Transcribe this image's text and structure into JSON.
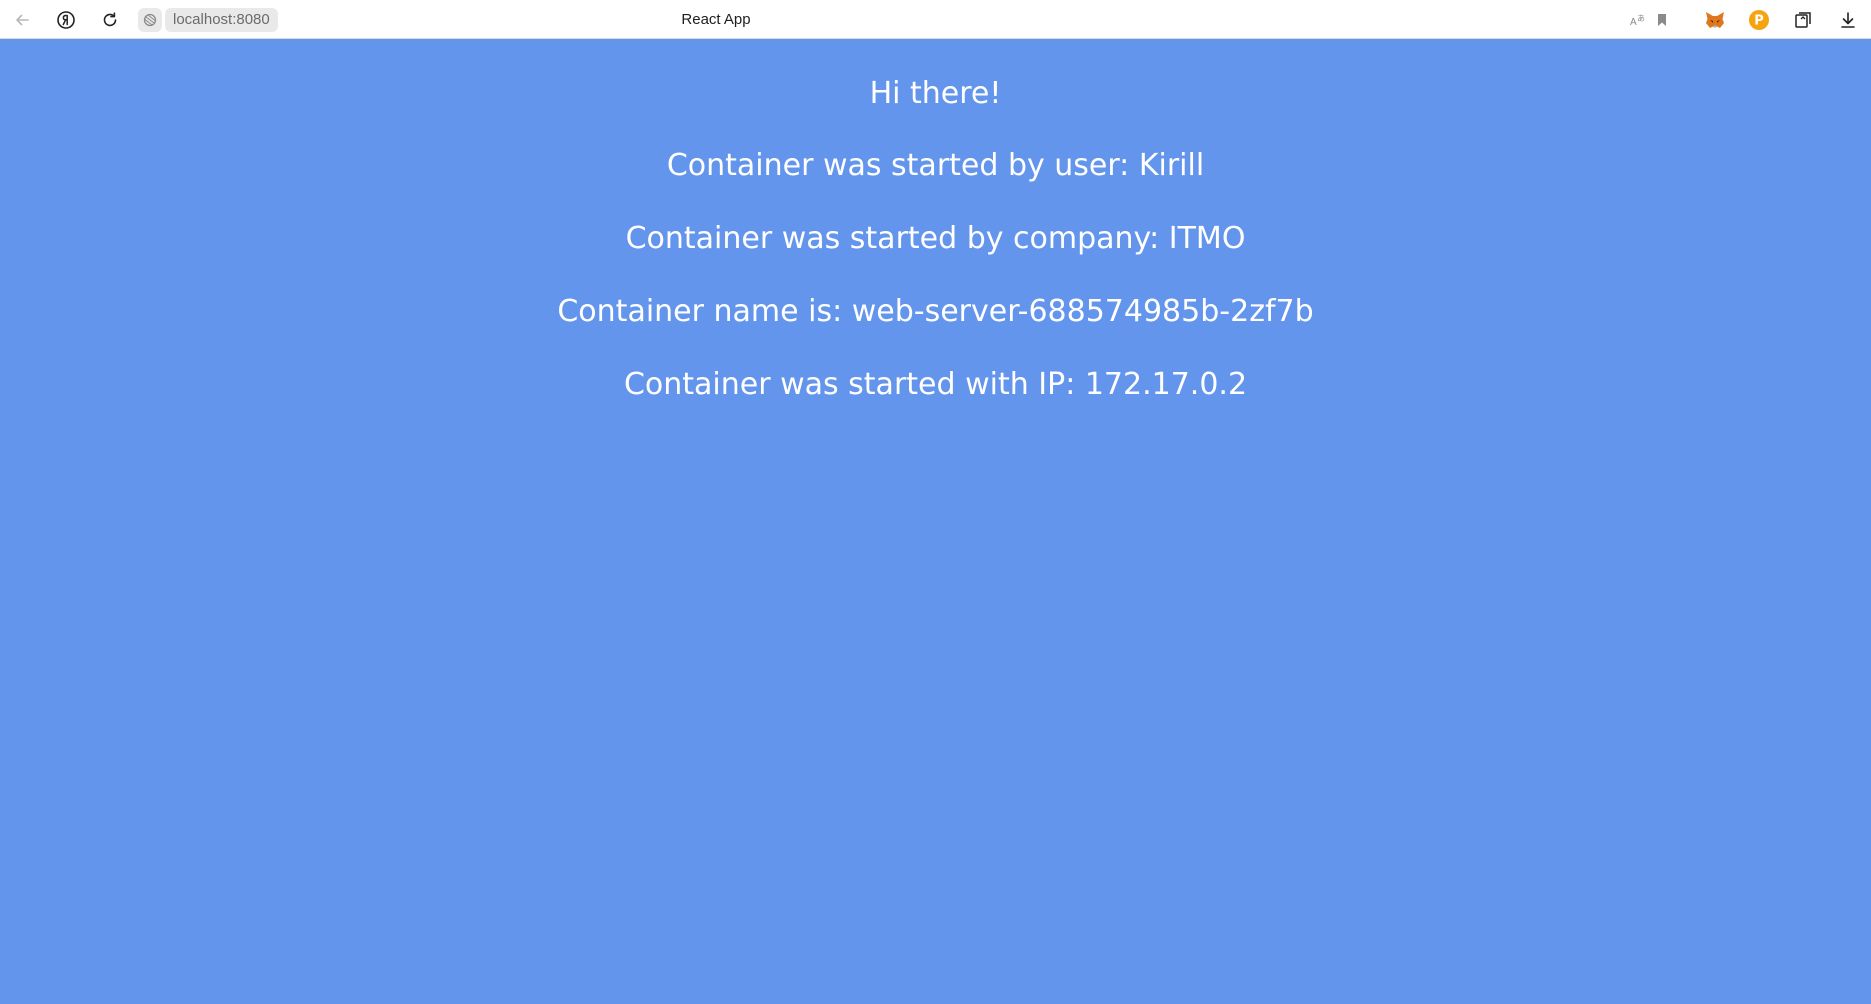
{
  "browser": {
    "url": "localhost:8080",
    "tab_title": "React App",
    "icons": {
      "back": "back-arrow-icon",
      "yandex": "yandex-logo-icon",
      "reload": "reload-icon",
      "site_info": "site-info-icon",
      "translate": "translate-icon",
      "bookmark": "bookmark-icon",
      "metamask": "metamask-fox-icon",
      "extension": "orange-p-extension-icon",
      "collections": "collections-icon",
      "downloads": "download-icon"
    },
    "colors": {
      "page_background": "#6495ED",
      "toolbar_background": "#ffffff",
      "text": "#ffffff"
    }
  },
  "page": {
    "greeting": "Hi there!",
    "user_line": "Container was started by user: Kirill",
    "company_line": "Container was started by company: ITMO",
    "name_line": "Container name is: web-server-688574985b-2zf7b",
    "ip_line": "Container was started with IP: 172.17.0.2"
  }
}
